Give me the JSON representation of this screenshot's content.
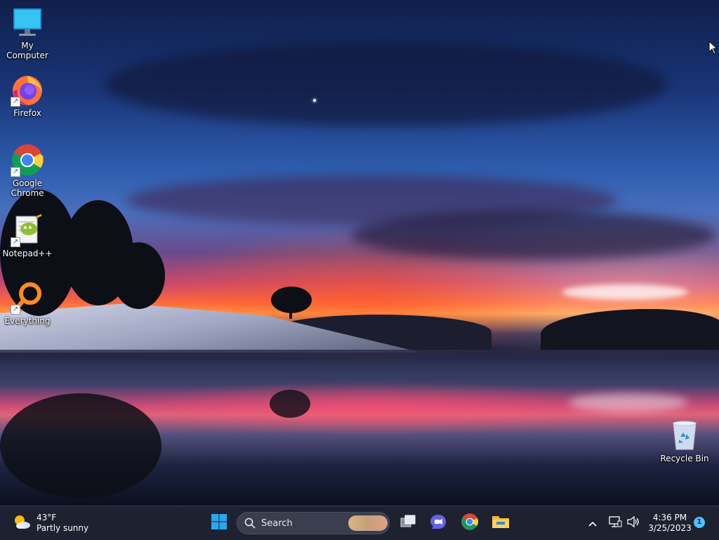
{
  "desktop": {
    "icons": [
      {
        "label": "My Computer",
        "icon": "computer-icon"
      },
      {
        "label": "Firefox",
        "icon": "firefox-icon"
      },
      {
        "label": "Google Chrome",
        "icon": "chrome-icon"
      },
      {
        "label": "Notepad++",
        "icon": "notepadpp-icon"
      },
      {
        "label": "Everything",
        "icon": "everything-icon"
      },
      {
        "label": "Recycle Bin",
        "icon": "recycle-bin-icon"
      }
    ]
  },
  "taskbar": {
    "weather": {
      "temp": "43°F",
      "condition": "Partly sunny"
    },
    "start_icon": "windows-start-icon",
    "search": {
      "label": "Search"
    },
    "pinned": [
      "task-view-icon",
      "teams-chat-icon",
      "chrome-icon",
      "file-explorer-icon"
    ],
    "tray": [
      "chevron-up-icon",
      "network-icon",
      "volume-icon"
    ],
    "clock": {
      "time": "4:36 PM",
      "date": "3/25/2023"
    },
    "notification_count": "1"
  },
  "colors": {
    "taskbar_bg": "#1e2230",
    "accent": "#4cc2ff",
    "windows_blue": "#29a8f0"
  }
}
